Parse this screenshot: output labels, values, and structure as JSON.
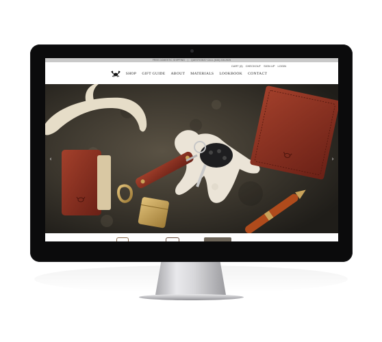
{
  "screen": {
    "topbar": {
      "shipping": "FREE DOMESTIC SHIPPING",
      "separator": "|",
      "questions": "QUESTIONS? CALL (646) 228-2525"
    },
    "utility_links": [
      "CART (0)",
      "CHECKOUT",
      "SIGN UP",
      "LOGIN"
    ],
    "nav": {
      "logo_icon": "crab-logo-icon",
      "items": [
        "SHOP",
        "GIFT GUIDE",
        "ABOUT",
        "MATERIALS",
        "LOOKBOOK",
        "CONTACT"
      ]
    },
    "hero": {
      "prev_arrow": "‹",
      "next_arrow": "›",
      "colors": {
        "stone": "#3a352c",
        "leather": "#8e2e1f",
        "antler": "#e9e1cf",
        "brass": "#c9a35a",
        "keys": "#2a2a2a"
      }
    }
  },
  "colors": {
    "bezel": "#0b0b0c",
    "topbar": "#c9c9c9",
    "page_bg": "#ffffff"
  }
}
